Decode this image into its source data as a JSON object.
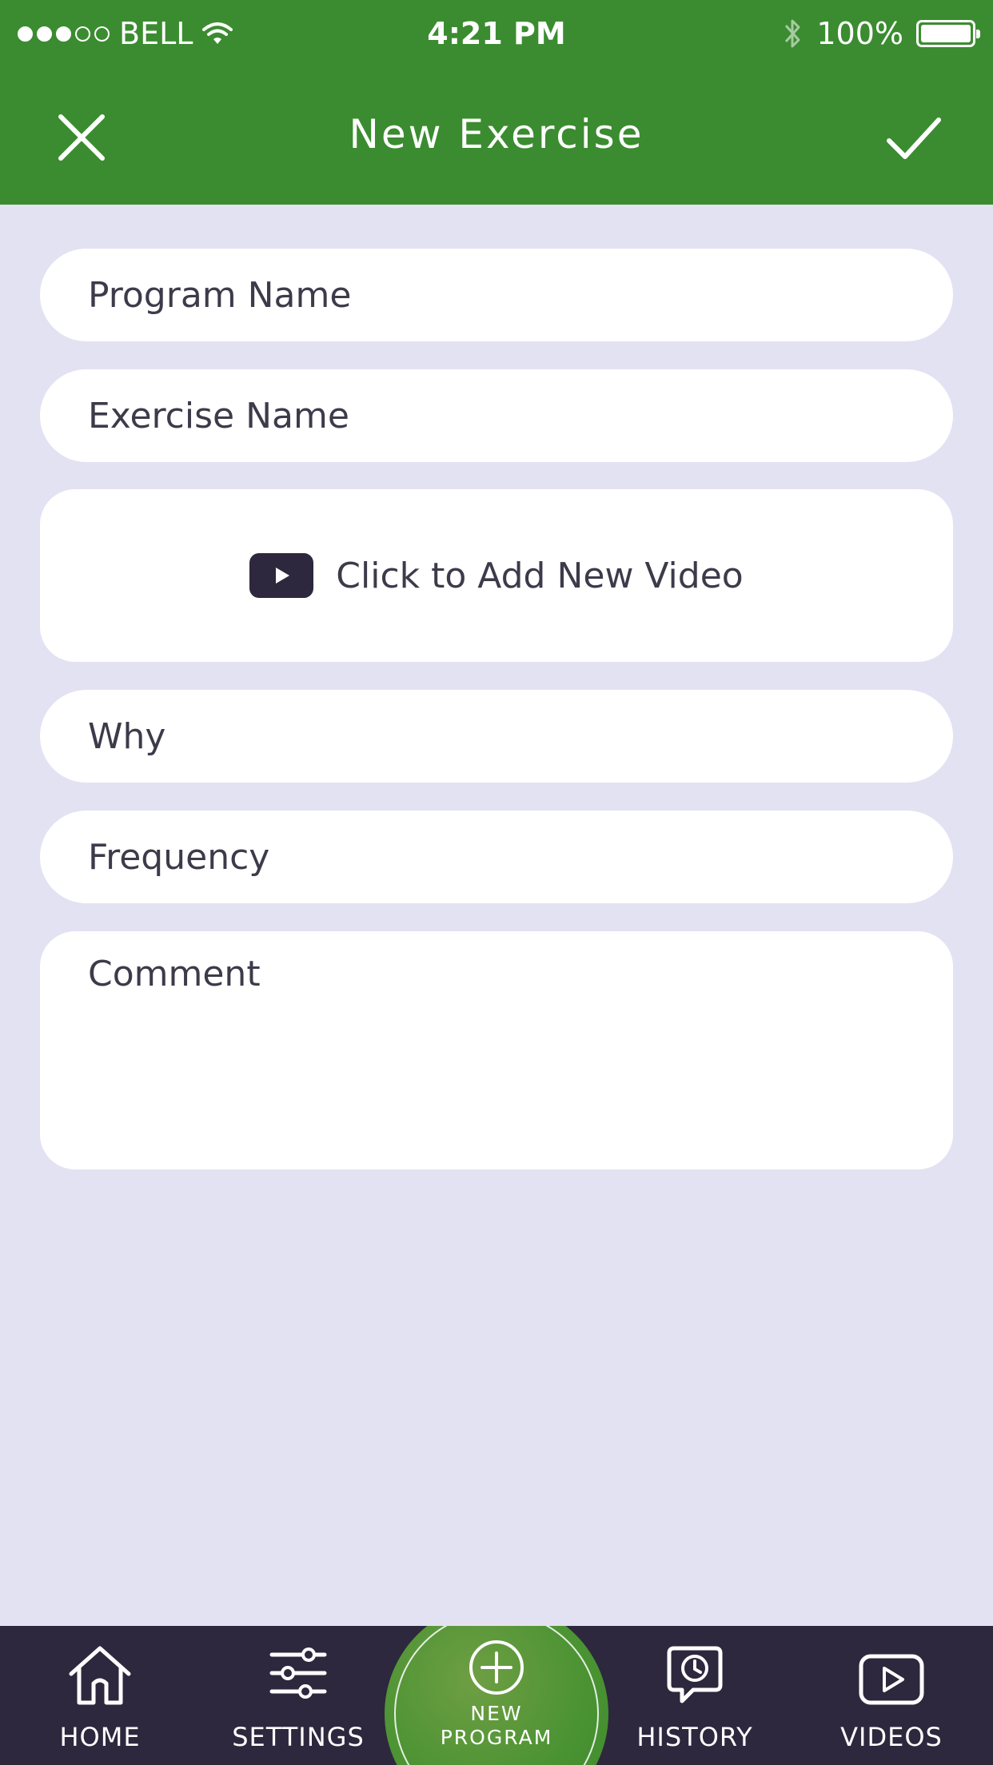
{
  "status_bar": {
    "carrier": "BELL",
    "time": "4:21 PM",
    "battery": "100%",
    "battery_level": 1.0,
    "signal_strength": 3,
    "signal_max": 5
  },
  "header": {
    "title": "New Exercise",
    "close_icon": "close-icon",
    "confirm_icon": "check-icon",
    "background_color": "#3b8c30"
  },
  "form": {
    "program_name_placeholder": "Program Name",
    "exercise_name_placeholder": "Exercise Name",
    "add_video_label": "Click to Add New Video",
    "why_placeholder": "Why",
    "frequency_placeholder": "Frequency",
    "comment_placeholder": "Comment",
    "background_color": "#e3e2f2"
  },
  "tab_bar": {
    "background_color": "#2d283d",
    "items": [
      {
        "label": "HOME",
        "icon": "home-icon"
      },
      {
        "label": "SETTINGS",
        "icon": "sliders-icon"
      },
      {
        "label_line1": "NEW",
        "label_line2": "PROGRAM",
        "icon": "plus-circle-icon"
      },
      {
        "label": "HISTORY",
        "icon": "history-icon"
      },
      {
        "label": "VIDEOS",
        "icon": "video-play-icon"
      }
    ]
  }
}
